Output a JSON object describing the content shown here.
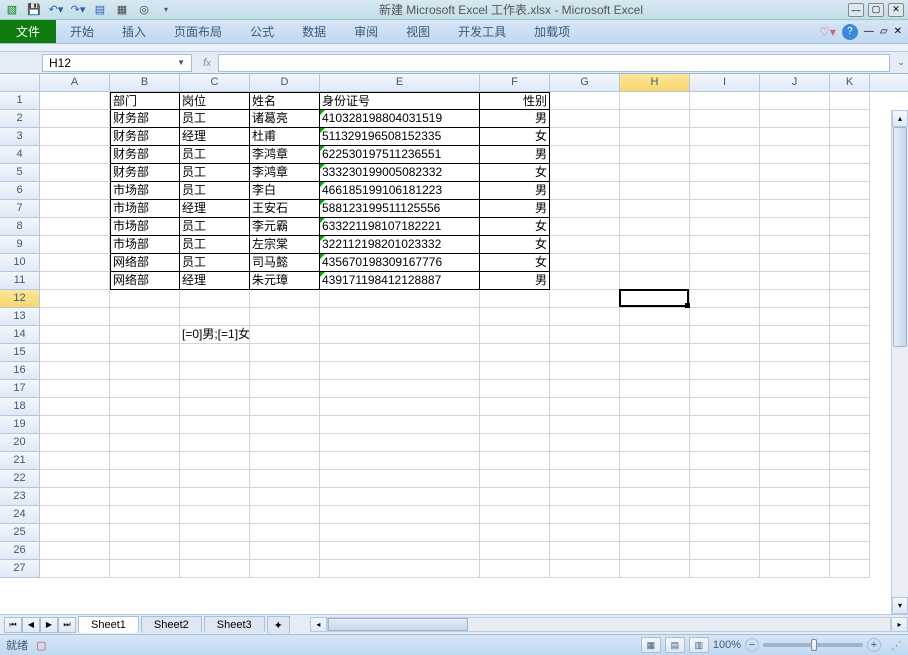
{
  "title": "新建 Microsoft Excel 工作表.xlsx - Microsoft Excel",
  "ribbon": {
    "file": "文件",
    "tabs": [
      "开始",
      "插入",
      "页面布局",
      "公式",
      "数据",
      "审阅",
      "视图",
      "开发工具",
      "加载项"
    ]
  },
  "namebox": "H12",
  "active_cell": {
    "col": "H",
    "row": 12
  },
  "columns": [
    "A",
    "B",
    "C",
    "D",
    "E",
    "F",
    "G",
    "H",
    "I",
    "J",
    "K"
  ],
  "col_widths": {
    "A": 70,
    "B": 70,
    "C": 70,
    "D": 70,
    "E": 160,
    "F": 70,
    "G": 70,
    "H": 70,
    "I": 70,
    "J": 70,
    "K": 40
  },
  "headers": {
    "B": "部门",
    "C": "岗位",
    "D": "姓名",
    "E": "身份证号",
    "F": "性别"
  },
  "data_rows": [
    {
      "B": "财务部",
      "C": "员工",
      "D": "诸葛亮",
      "E": "410328198804031519",
      "F": "男"
    },
    {
      "B": "财务部",
      "C": "经理",
      "D": "杜甫",
      "E": "511329196508152335",
      "F": "女"
    },
    {
      "B": "财务部",
      "C": "员工",
      "D": "李鸿章",
      "E": "622530197511236551",
      "F": "男"
    },
    {
      "B": "财务部",
      "C": "员工",
      "D": "李鸿章",
      "E": "333230199005082332",
      "F": "女"
    },
    {
      "B": "市场部",
      "C": "员工",
      "D": "李白",
      "E": "466185199106181223",
      "F": "男"
    },
    {
      "B": "市场部",
      "C": "经理",
      "D": "王安石",
      "E": "588123199511125556",
      "F": "男"
    },
    {
      "B": "市场部",
      "C": "员工",
      "D": "李元霸",
      "E": "633221198107182221",
      "F": "女"
    },
    {
      "B": "市场部",
      "C": "员工",
      "D": "左宗棠",
      "E": "322112198201023332",
      "F": "女"
    },
    {
      "B": "网络部",
      "C": "员工",
      "D": "司马懿",
      "E": "435670198309167776",
      "F": "女"
    },
    {
      "B": "网络部",
      "C": "经理",
      "D": "朱元璋",
      "E": "439171198412128887",
      "F": "男"
    }
  ],
  "note_cell": {
    "row": 14,
    "col": "C",
    "value": "[=0]男;[=1]女"
  },
  "visible_row_count": 27,
  "sheets": [
    "Sheet1",
    "Sheet2",
    "Sheet3"
  ],
  "active_sheet": 0,
  "status": "就绪",
  "zoom": "100%",
  "chart_data": null
}
